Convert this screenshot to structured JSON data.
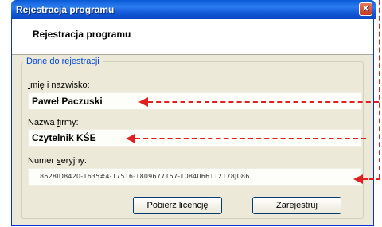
{
  "window": {
    "title": "Rejestracja programu",
    "close_glyph": "✕"
  },
  "header": {
    "title": "Rejestracja programu"
  },
  "group": {
    "legend": "Dane do rejestracji"
  },
  "fields": {
    "name": {
      "label_pre": "",
      "label_accel": "I",
      "label_post": "mię i nazwisko:",
      "value": "Paweł Paczuski"
    },
    "company": {
      "label_pre": "Nazwa ",
      "label_accel": "f",
      "label_post": "irmy:",
      "value": "Czytelnik KŚE"
    },
    "serial": {
      "label_pre": "Numer ",
      "label_accel": "s",
      "label_post": "eryjny:",
      "value": "8628ID8420-1635#4-17516-1809677157-1084066112178J086"
    }
  },
  "buttons": {
    "get_license": {
      "accel": "P",
      "rest": "obierz licencję"
    },
    "register": {
      "pre": "Zarej",
      "accel": "e",
      "post": "struj"
    }
  },
  "annotation": {
    "color": "#e02020"
  }
}
